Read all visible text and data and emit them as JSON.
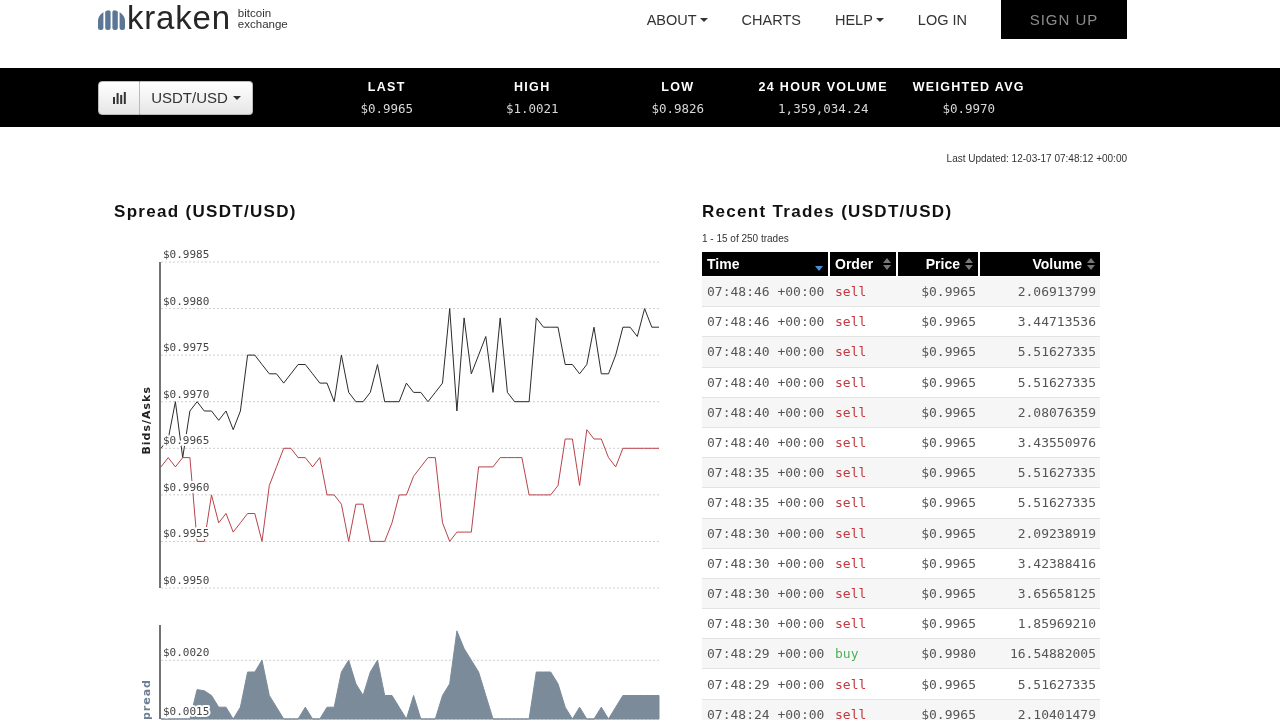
{
  "header": {
    "logo": {
      "wordmark": "kraken",
      "tagline": "bitcoin exchange"
    },
    "nav": [
      {
        "label": "ABOUT",
        "dropdown": true
      },
      {
        "label": "CHARTS",
        "dropdown": false
      },
      {
        "label": "HELP",
        "dropdown": true
      },
      {
        "label": "LOG IN",
        "dropdown": false
      }
    ],
    "signup_button": "SIGN UP"
  },
  "ticker": {
    "pair_select": "USDT/USD",
    "stats": [
      {
        "label": "LAST",
        "value": "$0.9965"
      },
      {
        "label": "HIGH",
        "value": "$1.0021"
      },
      {
        "label": "LOW",
        "value": "$0.9826"
      },
      {
        "label": "24 HOUR VOLUME",
        "value": "1,359,034.24"
      },
      {
        "label": "WEIGHTED AVG",
        "value": "$0.9970"
      }
    ]
  },
  "last_updated": "Last Updated: 12-03-17 07:48:12 +00:00",
  "spread": {
    "title": "Spread (USDT/USD)",
    "chart_data": {
      "type": "line",
      "ylabel": "Bids/Asks",
      "grid": true,
      "ylim": [
        0.995,
        0.9985
      ],
      "yticks": [
        {
          "value": 0.9985,
          "label": "$0.9985"
        },
        {
          "value": 0.998,
          "label": "$0.9980"
        },
        {
          "value": 0.9975,
          "label": "$0.9975"
        },
        {
          "value": 0.997,
          "label": "$0.9970"
        },
        {
          "value": 0.9965,
          "label": "$0.9965"
        },
        {
          "value": 0.996,
          "label": "$0.9960"
        },
        {
          "value": 0.9955,
          "label": "$0.9955"
        },
        {
          "value": 0.995,
          "label": "$0.9950"
        }
      ],
      "series": [
        {
          "color": "#2b2b2b",
          "values": [
            0.9965,
            0.9966,
            0.997,
            0.9964,
            0.9969,
            0.997,
            0.9969,
            0.9969,
            0.9968,
            0.9969,
            0.9967,
            0.9969,
            0.9975,
            0.9975,
            0.9974,
            0.9973,
            0.9973,
            0.9972,
            0.9973,
            0.9974,
            0.9974,
            0.9973,
            0.9972,
            0.9972,
            0.997,
            0.9975,
            0.9971,
            0.997,
            0.997,
            0.9971,
            0.9974,
            0.997,
            0.997,
            0.997,
            0.9972,
            0.9971,
            0.9971,
            0.997,
            0.9971,
            0.9972,
            0.998,
            0.9969,
            0.9979,
            0.9973,
            0.9975,
            0.9977,
            0.9971,
            0.9979,
            0.9971,
            0.997,
            0.997,
            0.997,
            0.9979,
            0.9978,
            0.9978,
            0.9978,
            0.9974,
            0.9974,
            0.9973,
            0.9974,
            0.9978,
            0.9973,
            0.9973,
            0.9975,
            0.9978,
            0.9978,
            0.9977,
            0.998,
            0.9978,
            0.9978
          ]
        },
        {
          "color": "#b8434a",
          "values": [
            0.9963,
            0.9964,
            0.9963,
            0.9964,
            0.9964,
            0.9955,
            0.9955,
            0.996,
            0.9957,
            0.9958,
            0.9956,
            0.9957,
            0.9958,
            0.9958,
            0.9955,
            0.9961,
            0.9963,
            0.9965,
            0.9965,
            0.9964,
            0.9964,
            0.9963,
            0.9964,
            0.996,
            0.996,
            0.9959,
            0.9955,
            0.9959,
            0.9959,
            0.9955,
            0.9955,
            0.9955,
            0.9957,
            0.996,
            0.996,
            0.9962,
            0.9963,
            0.9964,
            0.9964,
            0.9957,
            0.9955,
            0.9956,
            0.9956,
            0.9956,
            0.9963,
            0.9963,
            0.9963,
            0.9964,
            0.9964,
            0.9964,
            0.9964,
            0.996,
            0.996,
            0.996,
            0.996,
            0.9961,
            0.9966,
            0.9966,
            0.9961,
            0.9967,
            0.9966,
            0.9966,
            0.9964,
            0.9963,
            0.9965,
            0.9965,
            0.9965,
            0.9965,
            0.9965,
            0.9965
          ]
        }
      ]
    },
    "spread_chart": {
      "chart_data": {
        "type": "area",
        "ylabel": "pread",
        "grid": true,
        "ylim": [
          0.0015,
          0.0023
        ],
        "yticks": [
          {
            "value": 0.002,
            "label": "$0.0020"
          },
          {
            "value": 0.0015,
            "label": "$0.0015"
          }
        ],
        "series": [
          {
            "color": "#7b8b9a",
            "values": [
              0.0015,
              0.0015,
              0.0015,
              0.0015,
              0.0015,
              0.00175,
              0.00174,
              0.0017,
              0.0016,
              0.0016,
              0.0015,
              0.0016,
              0.0019,
              0.0019,
              0.002,
              0.0017,
              0.0016,
              0.0015,
              0.0015,
              0.0015,
              0.0016,
              0.0015,
              0.0015,
              0.0016,
              0.0016,
              0.0019,
              0.002,
              0.0018,
              0.0017,
              0.0019,
              0.002,
              0.0017,
              0.0017,
              0.0016,
              0.0015,
              0.0017,
              0.0015,
              0.0015,
              0.0015,
              0.0017,
              0.0018,
              0.00225,
              0.0021,
              0.002,
              0.0019,
              0.0017,
              0.0015,
              0.0015,
              0.0015,
              0.0015,
              0.0015,
              0.0015,
              0.0019,
              0.0019,
              0.0019,
              0.0018,
              0.0016,
              0.0015,
              0.0016,
              0.0015,
              0.0015,
              0.0016,
              0.0015,
              0.0016,
              0.0017,
              0.0017,
              0.0017,
              0.0017,
              0.0017,
              0.0017
            ]
          }
        ]
      }
    }
  },
  "trades": {
    "title": "Recent Trades (USDT/USD)",
    "count": "1 - 15 of 250 trades",
    "columns": [
      {
        "label": "Time",
        "sorted": true
      },
      {
        "label": "Order",
        "sorted": false
      },
      {
        "label": "Price",
        "sorted": false
      },
      {
        "label": "Volume",
        "sorted": false
      }
    ],
    "rows": [
      {
        "time": "07:48:46 +00:00",
        "order": "sell",
        "color": "#c23a41",
        "price": "$0.9965",
        "volume": "2.06913799"
      },
      {
        "time": "07:48:46 +00:00",
        "order": "sell",
        "color": "#c23a41",
        "price": "$0.9965",
        "volume": "3.44713536"
      },
      {
        "time": "07:48:40 +00:00",
        "order": "sell",
        "color": "#c23a41",
        "price": "$0.9965",
        "volume": "5.51627335"
      },
      {
        "time": "07:48:40 +00:00",
        "order": "sell",
        "color": "#c23a41",
        "price": "$0.9965",
        "volume": "5.51627335"
      },
      {
        "time": "07:48:40 +00:00",
        "order": "sell",
        "color": "#c23a41",
        "price": "$0.9965",
        "volume": "2.08076359"
      },
      {
        "time": "07:48:40 +00:00",
        "order": "sell",
        "color": "#c23a41",
        "price": "$0.9965",
        "volume": "3.43550976"
      },
      {
        "time": "07:48:35 +00:00",
        "order": "sell",
        "color": "#c23a41",
        "price": "$0.9965",
        "volume": "5.51627335"
      },
      {
        "time": "07:48:35 +00:00",
        "order": "sell",
        "color": "#c23a41",
        "price": "$0.9965",
        "volume": "5.51627335"
      },
      {
        "time": "07:48:30 +00:00",
        "order": "sell",
        "color": "#c23a41",
        "price": "$0.9965",
        "volume": "2.09238919"
      },
      {
        "time": "07:48:30 +00:00",
        "order": "sell",
        "color": "#c23a41",
        "price": "$0.9965",
        "volume": "3.42388416"
      },
      {
        "time": "07:48:30 +00:00",
        "order": "sell",
        "color": "#c23a41",
        "price": "$0.9965",
        "volume": "3.65658125"
      },
      {
        "time": "07:48:30 +00:00",
        "order": "sell",
        "color": "#c23a41",
        "price": "$0.9965",
        "volume": "1.85969210"
      },
      {
        "time": "07:48:29 +00:00",
        "order": "buy",
        "color": "#4cb35a",
        "price": "$0.9980",
        "volume": "16.54882005"
      },
      {
        "time": "07:48:29 +00:00",
        "order": "sell",
        "color": "#c23a41",
        "price": "$0.9965",
        "volume": "5.51627335"
      },
      {
        "time": "07:48:24 +00:00",
        "order": "sell",
        "color": "#c23a41",
        "price": "$0.9965",
        "volume": "2.10401479"
      }
    ]
  }
}
